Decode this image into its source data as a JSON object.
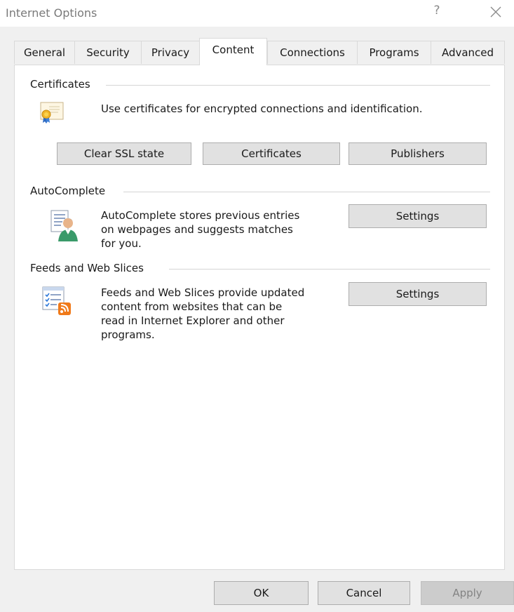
{
  "window": {
    "title": "Internet Options",
    "help_glyph": "?"
  },
  "tabs": [
    {
      "label": "General"
    },
    {
      "label": "Security"
    },
    {
      "label": "Privacy"
    },
    {
      "label": "Content"
    },
    {
      "label": "Connections"
    },
    {
      "label": "Programs"
    },
    {
      "label": "Advanced"
    }
  ],
  "active_tab": "Content",
  "certificates": {
    "label": "Certificates",
    "description": "Use certificates for encrypted connections and identification.",
    "clear_ssl_label": "Clear SSL state",
    "certificates_label": "Certificates",
    "publishers_label": "Publishers"
  },
  "autocomplete": {
    "label": "AutoComplete",
    "description_lines": [
      "AutoComplete stores previous entries",
      "on webpages and suggests matches",
      "for you."
    ],
    "settings_label": "Settings"
  },
  "feeds": {
    "label": "Feeds and Web Slices",
    "description_lines": [
      "Feeds and Web Slices provide updated",
      "content from websites that can be",
      "read in Internet Explorer and other",
      "programs."
    ],
    "settings_label": "Settings"
  },
  "footer": {
    "ok_label": "OK",
    "cancel_label": "Cancel",
    "apply_label": "Apply"
  },
  "icons": {
    "certificate": "certificate-icon",
    "autocomplete": "autocomplete-icon",
    "feeds": "feeds-icon",
    "close": "close-icon"
  },
  "colors": {
    "window_bg": "#f0f0f0",
    "panel_bg": "#ffffff",
    "button_bg": "#e1e1e1",
    "button_border": "#adadad",
    "title_text": "#7a7a7a"
  }
}
